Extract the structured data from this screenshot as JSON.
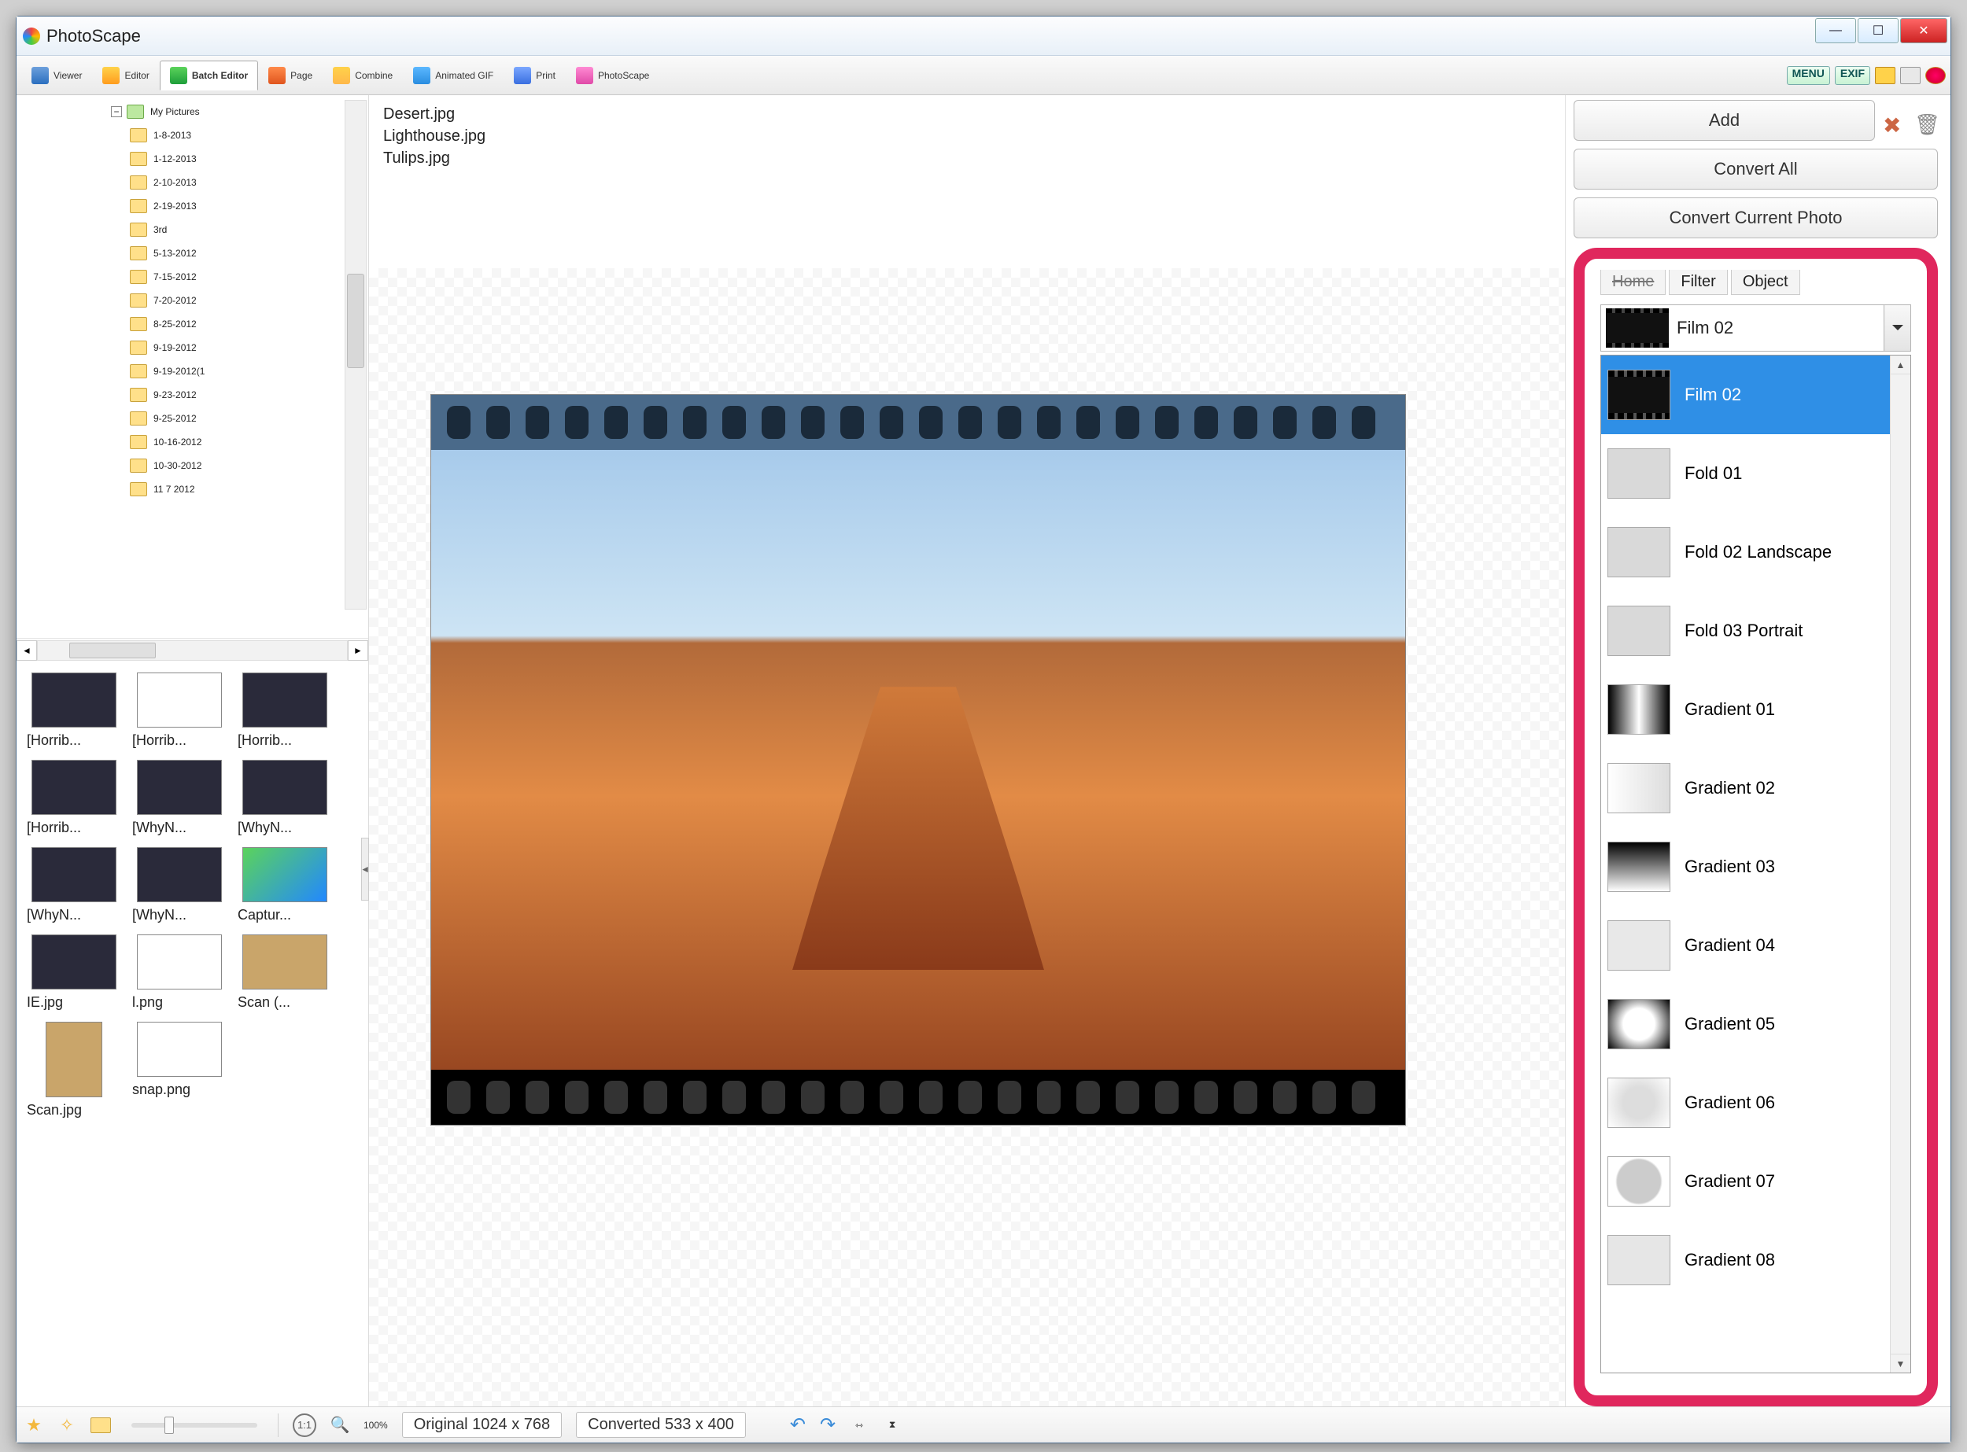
{
  "window": {
    "title": "PhotoScape"
  },
  "toolbar": {
    "tabs": [
      "Viewer",
      "Editor",
      "Batch Editor",
      "Page",
      "Combine",
      "Animated GIF",
      "Print",
      "PhotoScape"
    ],
    "active_index": 2,
    "menu_badge": "MENU",
    "exif_badge": "EXIF"
  },
  "tree": {
    "root": "My Pictures",
    "folders": [
      "1-8-2013",
      "1-12-2013",
      "2-10-2013",
      "2-19-2013",
      "3rd",
      "5-13-2012",
      "7-15-2012",
      "7-20-2012",
      "8-25-2012",
      "9-19-2012",
      "9-19-2012(1",
      "9-23-2012",
      "9-25-2012",
      "10-16-2012",
      "10-30-2012",
      "11 7 2012"
    ]
  },
  "thumbs": [
    {
      "label": "[Horrib...",
      "kind": "dark"
    },
    {
      "label": "[Horrib...",
      "kind": "white"
    },
    {
      "label": "[Horrib...",
      "kind": "dark"
    },
    {
      "label": "[Horrib...",
      "kind": "dark"
    },
    {
      "label": "[WhyN...",
      "kind": "dark"
    },
    {
      "label": "[WhyN...",
      "kind": "dark"
    },
    {
      "label": "[WhyN...",
      "kind": "dark"
    },
    {
      "label": "[WhyN...",
      "kind": "dark"
    },
    {
      "label": "Captur...",
      "kind": "color"
    },
    {
      "label": "IE.jpg",
      "kind": "dark"
    },
    {
      "label": "l.png",
      "kind": "white"
    },
    {
      "label": "Scan (...",
      "kind": "sepia"
    },
    {
      "label": "Scan.jpg",
      "kind": "sepia",
      "tall": true
    },
    {
      "label": "snap.png",
      "kind": "white"
    }
  ],
  "files": [
    "Desert.jpg",
    "Lighthouse.jpg",
    "Tulips.jpg"
  ],
  "right": {
    "add": "Add",
    "convert_all": "Convert All",
    "convert_current": "Convert Current Photo",
    "tabs": [
      "Home",
      "Filter",
      "Object"
    ],
    "combo_selected": "Film 02",
    "options": [
      {
        "label": "Film 02",
        "swatch": "film",
        "selected": true
      },
      {
        "label": "Fold 01",
        "swatch": "fold"
      },
      {
        "label": "Fold 02 Landscape",
        "swatch": "fold"
      },
      {
        "label": "Fold 03 Portrait",
        "swatch": "fold"
      },
      {
        "label": "Gradient 01",
        "swatch": "g1"
      },
      {
        "label": "Gradient 02",
        "swatch": "g2"
      },
      {
        "label": "Gradient 03",
        "swatch": "g3"
      },
      {
        "label": "Gradient 04",
        "swatch": "g4"
      },
      {
        "label": "Gradient 05",
        "swatch": "g5"
      },
      {
        "label": "Gradient 06",
        "swatch": "g6"
      },
      {
        "label": "Gradient 07",
        "swatch": "g7"
      },
      {
        "label": "Gradient 08",
        "swatch": "g8"
      }
    ]
  },
  "status": {
    "zoom": "100%",
    "original": "Original 1024 x 768",
    "converted": "Converted 533 x 400"
  }
}
